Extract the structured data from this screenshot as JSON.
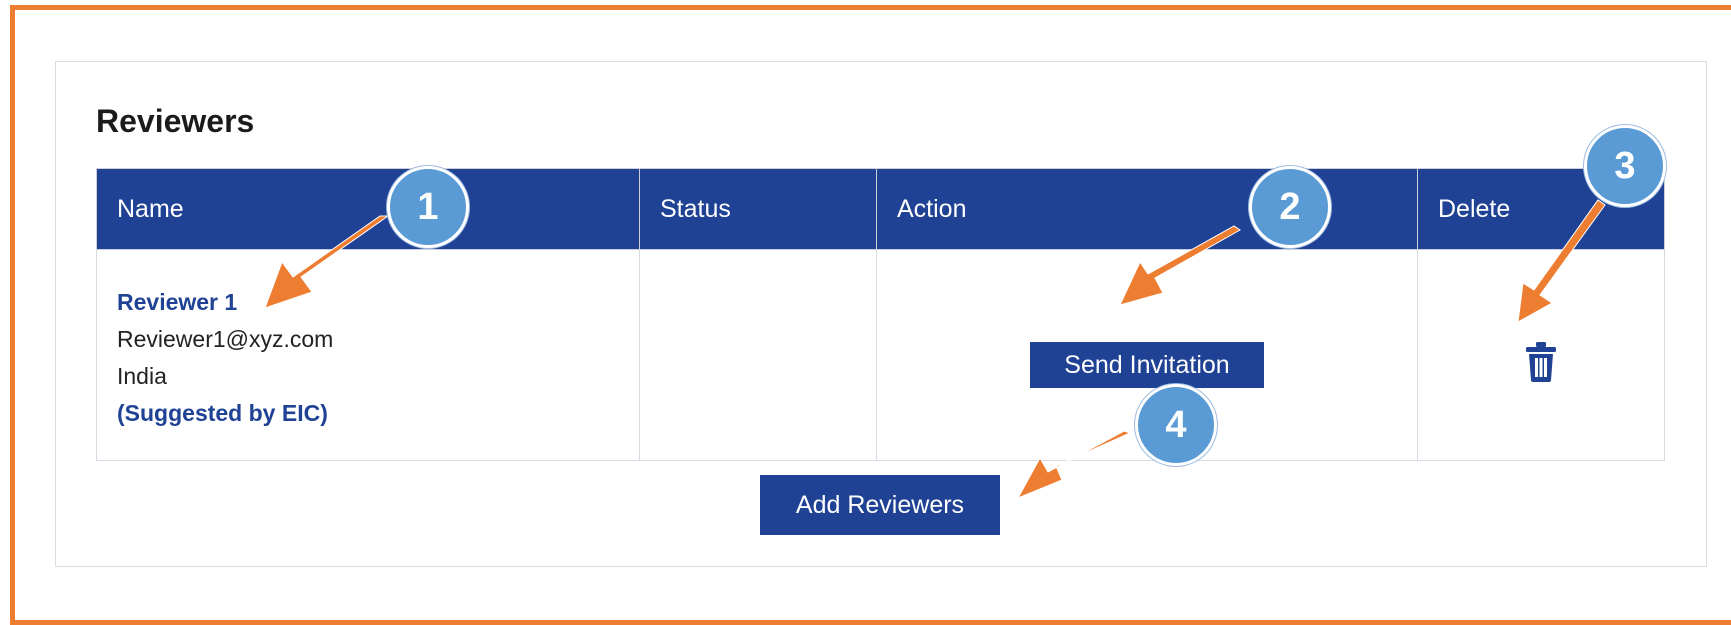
{
  "section": {
    "title": "Reviewers"
  },
  "table": {
    "headers": [
      "Name",
      "Status",
      "Action",
      "Delete"
    ],
    "rows": [
      {
        "name": "Reviewer 1",
        "email": "Reviewer1@xyz.com",
        "country": "India",
        "suggested": "(Suggested by EIC)",
        "status": "",
        "action_label": "Send Invitation",
        "delete_icon": "trash-icon"
      }
    ]
  },
  "add_button_label": "Add Reviewers",
  "callouts": [
    "1",
    "2",
    "3",
    "4"
  ],
  "colors": {
    "primary": "#1F4295",
    "frame": "#ED7D31",
    "callout": "#5B9BD5",
    "arrow": "#ED7D31"
  }
}
